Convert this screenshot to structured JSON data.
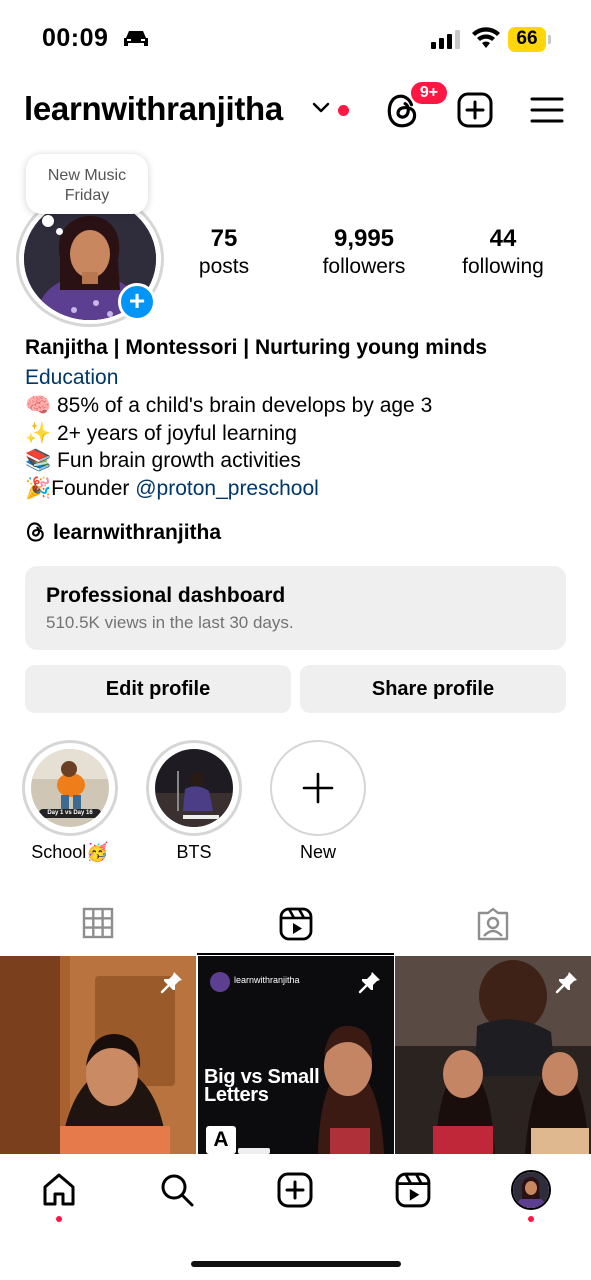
{
  "status_bar": {
    "time": "00:09",
    "battery": "66"
  },
  "header": {
    "username": "learnwithranjitha",
    "threads_badge": "9+"
  },
  "note": {
    "text_line1": "New Music",
    "text_line2": "Friday"
  },
  "stats": {
    "posts": {
      "count": "75",
      "label": "posts"
    },
    "followers": {
      "count": "9,995",
      "label": "followers"
    },
    "following": {
      "count": "44",
      "label": "following"
    }
  },
  "bio": {
    "name": "Ranjitha | Montessori | Nurturing young minds",
    "category": "Education",
    "lines": [
      {
        "emoji": "🧠",
        "text": " 85% of a child's brain develops by age 3"
      },
      {
        "emoji": "✨",
        "text": " 2+ years of joyful learning"
      },
      {
        "emoji": "📚",
        "text": " Fun brain growth activities"
      }
    ],
    "founder_emoji": "🎉",
    "founder_prefix": "Founder ",
    "founder_mention": "@proton_preschool"
  },
  "threads_link": "learnwithranjitha",
  "dashboard": {
    "title": "Professional dashboard",
    "subtitle": "510.5K views in the last 30 days."
  },
  "buttons": {
    "edit": "Edit profile",
    "share": "Share profile"
  },
  "highlights": [
    {
      "label": "School🥳",
      "thumb_caption": "Day 1 vs Day 16"
    },
    {
      "label": "BTS"
    },
    {
      "label": "New"
    }
  ],
  "grid": [
    {
      "type": "reel",
      "pinned": true
    },
    {
      "type": "reel",
      "pinned": true,
      "account": "learnwithranjitha",
      "title_line1": "Big vs Small",
      "title_line2": "Letters",
      "letter": "A"
    },
    {
      "type": "reel",
      "pinned": true
    }
  ],
  "colors": {
    "accent_blue": "#0095f6",
    "badge_red": "#ff1744",
    "link_blue": "#00376b",
    "button_gray": "#efefef"
  }
}
